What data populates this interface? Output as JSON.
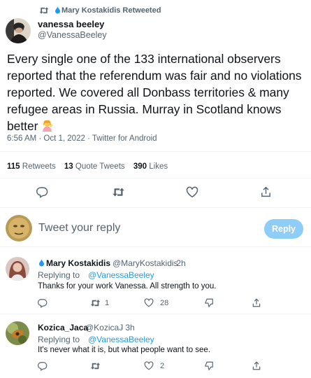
{
  "retweet_banner": {
    "text": "Mary Kostakidis Retweeted"
  },
  "tweet": {
    "author_name": "vanessa beeley",
    "author_handle": "@VanessaBeeley",
    "text": "Every single one of the 133 international observers reported that the referendum was fair and no violations reported. We covered all Donbass territories & many refugee areas in Russia. Murray in Scotland knows better",
    "emoji": "woman-tipping-hand",
    "timestamp": "6:56 AM · Oct 1, 2022 · Twitter for Android",
    "stats": {
      "retweets_count": "115",
      "retweets_label": "Retweets",
      "quotes_count": "13",
      "quotes_label": "Quote Tweets",
      "likes_count": "390",
      "likes_label": "Likes"
    }
  },
  "compose": {
    "placeholder": "Tweet your reply",
    "reply_button": "Reply"
  },
  "replies": [
    {
      "name": "Mary Kostakidis",
      "handle": "@MaryKostakidis",
      "time": "· 2h",
      "replying_prefix": "Replying to",
      "replying_to": "@VanessaBeeley",
      "text": "Thanks for your work Vanessa. All strength to you.",
      "retweets": "1",
      "likes": "28"
    },
    {
      "name": "Kozica_Jaca",
      "handle": "@KozicaJ",
      "time": "· 3h",
      "replying_prefix": "Replying to",
      "replying_to": "@VanessaBeeley",
      "text": "It's never what it is, but what people want to see.",
      "likes": "2"
    }
  ],
  "colors": {
    "accent": "#1d9bf0",
    "reply_button_disabled": "#8ecdf8",
    "muted": "#536471"
  }
}
